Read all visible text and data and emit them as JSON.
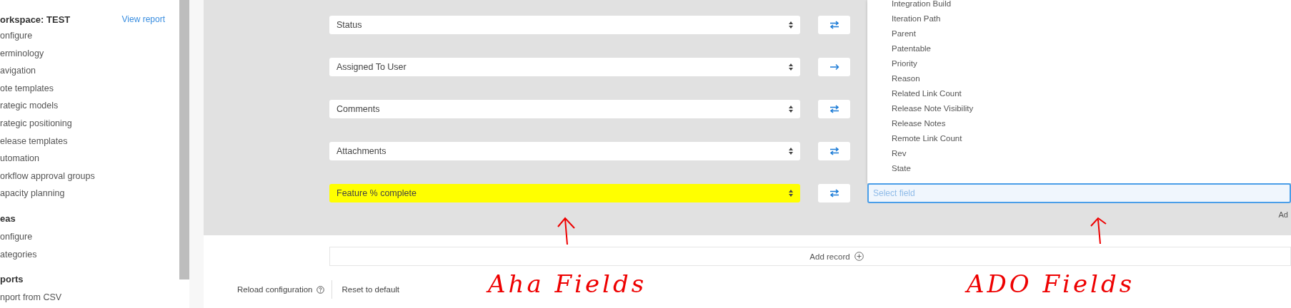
{
  "sidebar": {
    "title": "orkspace: TEST",
    "report_link": "View report",
    "sections": [
      {
        "items": [
          "onfigure",
          "erminology",
          "avigation",
          "ote templates",
          "rategic models",
          "rategic positioning",
          "elease templates",
          "utomation",
          "orkflow approval groups",
          "apacity planning"
        ]
      },
      {
        "heading": "eas",
        "items": [
          "onfigure",
          "ategories"
        ]
      },
      {
        "heading": "ports",
        "items": [
          "nport from CSV"
        ]
      }
    ]
  },
  "mappings": [
    {
      "field": "Status",
      "two_way": true,
      "highlighted": false
    },
    {
      "field": "Assigned To User",
      "two_way": false,
      "highlighted": false
    },
    {
      "field": "Comments",
      "two_way": true,
      "highlighted": false
    },
    {
      "field": "Attachments",
      "two_way": true,
      "highlighted": false
    },
    {
      "field": "Feature % complete",
      "two_way": true,
      "highlighted": true
    }
  ],
  "dropdown": {
    "options": [
      "Integration Build",
      "Iteration Path",
      "Parent",
      "Patentable",
      "Priority",
      "Reason",
      "Related Link Count",
      "Release Note Visibility",
      "Release Notes",
      "Remote Link Count",
      "Rev",
      "State"
    ],
    "placeholder": "Select field"
  },
  "cut_label": "Ad",
  "add_record": "Add record",
  "footer": {
    "reload": "Reload configuration",
    "reset": "Reset to default"
  },
  "annotations": [
    {
      "text": "Aha Fields"
    },
    {
      "text": "ADO Fields"
    }
  ]
}
